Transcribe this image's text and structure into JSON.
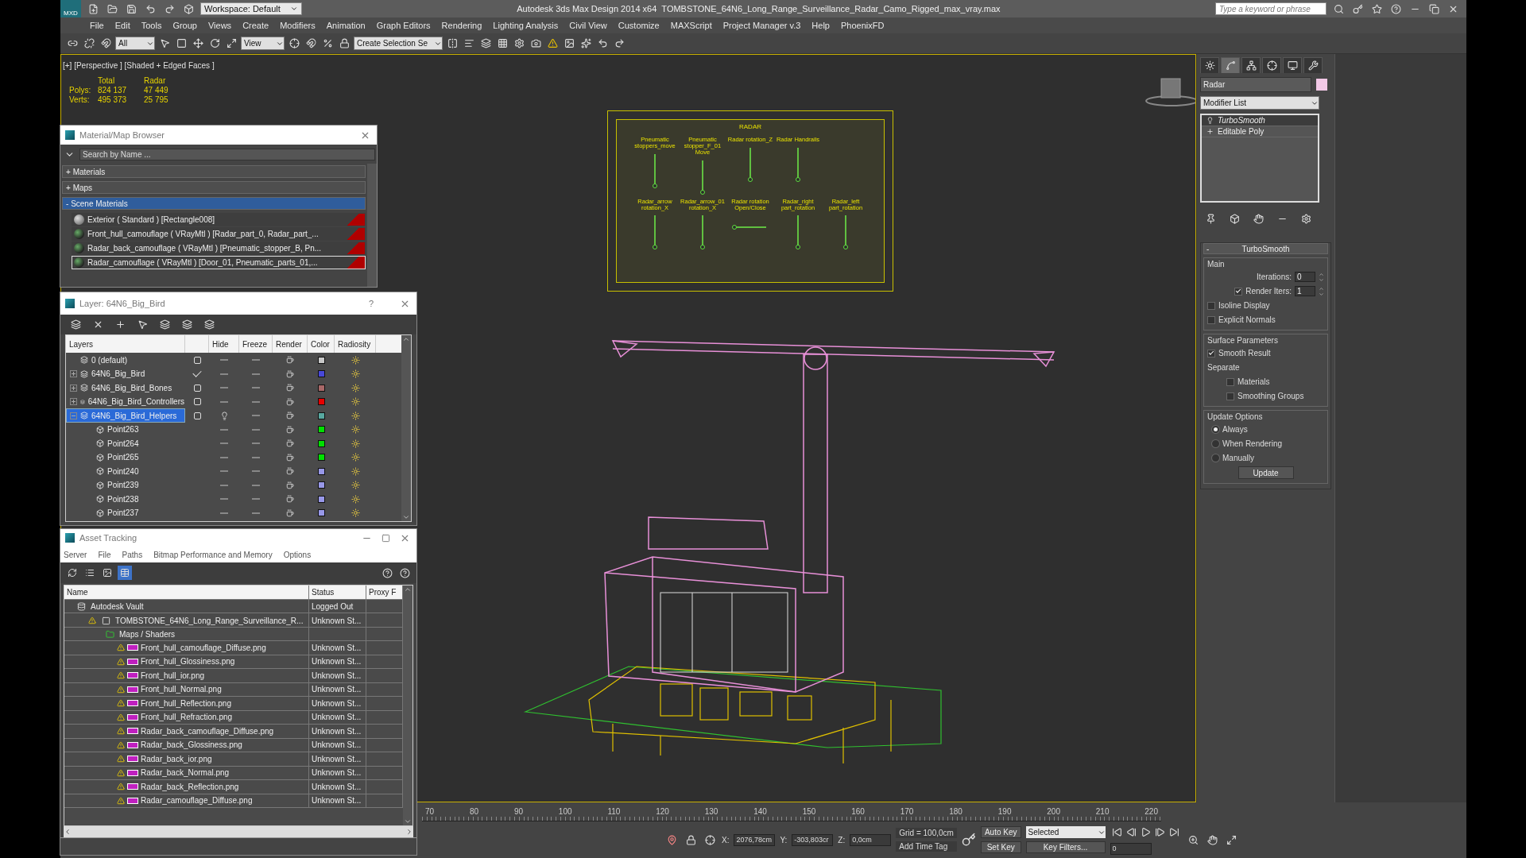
{
  "title_bar": {
    "logo": "MXD",
    "workspace": "Workspace: Default",
    "app_title": "Autodesk 3ds Max Design 2014 x64",
    "file_name": "TOMBSTONE_64N6_Long_Range_Surveillance_Radar_Camo_Rigged_max_vray.max",
    "search_placeholder": "Type a keyword or phrase"
  },
  "menu": [
    "File",
    "Edit",
    "Tools",
    "Group",
    "Views",
    "Create",
    "Modifiers",
    "Animation",
    "Graph Editors",
    "Rendering",
    "Lighting Analysis",
    "Civil View",
    "Customize",
    "MAXScript",
    "Project Manager v.3",
    "Help",
    "PhoenixFD"
  ],
  "toolbar": {
    "selection_filter": "All",
    "reference_coord": "View",
    "named_selection": "Create Selection Se"
  },
  "viewport": {
    "label": "[+] [Perspective ] [Shaded + Edged Faces ]",
    "stats": {
      "columns": [
        "Total",
        "Radar"
      ],
      "rows": [
        {
          "label": "Polys:",
          "values": [
            "824 137",
            "47 449"
          ]
        },
        {
          "label": "Verts:",
          "values": [
            "495 373",
            "25 795"
          ]
        }
      ]
    },
    "schematic": {
      "title": "RADAR",
      "top_controls": [
        {
          "label": "Pneumatic stoppers_move",
          "kind": "vertical"
        },
        {
          "label": "Pneumatic stopper_F_01 Move",
          "kind": "vertical"
        },
        {
          "label": "Radar rotation_Z",
          "kind": "vertical"
        },
        {
          "label": "Radar Handrails",
          "kind": "vertical"
        }
      ],
      "bottom_controls": [
        {
          "label": "Radar_arrow rotation_X",
          "kind": "vertical"
        },
        {
          "label": "Radar_arrow_01 rotation_X",
          "kind": "vertical"
        },
        {
          "label": "Radar rotation Open/Close",
          "kind": "horizontal"
        },
        {
          "label": "Radar_right part_rotation",
          "kind": "vertical"
        },
        {
          "label": "Radar_left part_rotation",
          "kind": "vertical"
        }
      ]
    }
  },
  "material_browser": {
    "title": "Material/Map Browser",
    "search_placeholder": "Search by Name ...",
    "groups": [
      {
        "marker": "+",
        "label": "Materials",
        "expanded": false
      },
      {
        "marker": "+",
        "label": "Maps",
        "expanded": false
      },
      {
        "marker": "-",
        "label": "Scene Materials",
        "expanded": true,
        "items": [
          {
            "name": "Exterior ( Standard ) [Rectangle008]",
            "kind": "standard",
            "selected": false
          },
          {
            "name": "Front_hull_camouflage ( VRayMtl ) [Radar_part_0, Radar_part_...",
            "kind": "vray",
            "selected": false
          },
          {
            "name": "Radar_back_camouflage ( VRayMtl ) [Pneumatic_stopper_B, Pn...",
            "kind": "vray",
            "selected": false
          },
          {
            "name": "Radar_camouflage ( VRayMtl ) [Door_01, Pneumatic_parts_01,...",
            "kind": "vray",
            "selected": true
          }
        ]
      }
    ]
  },
  "layer_manager": {
    "title": "Layer: 64N6_Big_Bird",
    "help": "?",
    "columns": [
      "Layers",
      "Hide",
      "Freeze",
      "Render",
      "Color",
      "Radiosity"
    ],
    "layers": [
      {
        "name": "0 (default)",
        "current": false,
        "hidden": false,
        "color": "#c8c8c8",
        "selected": false
      },
      {
        "name": "64N6_Big_Bird",
        "current": true,
        "hidden": false,
        "color": "#4848d8",
        "selected": false,
        "expanded": false
      },
      {
        "name": "64N6_Big_Bird_Bones",
        "current": false,
        "hidden": false,
        "color": "#a86868",
        "selected": false,
        "expanded": false
      },
      {
        "name": "64N6_Big_Bird_Controllers",
        "current": false,
        "hidden": false,
        "color": "#e80000",
        "selected": false,
        "expanded": false
      },
      {
        "name": "64N6_Big_Bird_Helpers",
        "current": false,
        "hidden": true,
        "color": "#58a8a0",
        "selected": true,
        "expanded": true,
        "children": [
          {
            "name": "Point263",
            "hidden": false,
            "color": "#00e000",
            "selected": false
          },
          {
            "name": "Point264",
            "hidden": false,
            "color": "#00e000",
            "selected": false
          },
          {
            "name": "Point265",
            "hidden": false,
            "color": "#00e000",
            "selected": false
          },
          {
            "name": "Point240",
            "hidden": false,
            "color": "#9898e8",
            "selected": false
          },
          {
            "name": "Point239",
            "hidden": false,
            "color": "#9898e8",
            "selected": false
          },
          {
            "name": "Point238",
            "hidden": false,
            "color": "#9898e8",
            "selected": false
          },
          {
            "name": "Point237",
            "hidden": false,
            "color": "#9898e8",
            "selected": false
          }
        ]
      }
    ]
  },
  "asset_tracking": {
    "title": "Asset Tracking",
    "menu": [
      "Server",
      "File",
      "Paths",
      "Bitmap Performance and Memory",
      "Options"
    ],
    "view_buttons": [
      {
        "kind": "refresh",
        "selected": false
      },
      {
        "kind": "list",
        "selected": false
      },
      {
        "kind": "thumbnails",
        "selected": false
      },
      {
        "kind": "table",
        "selected": true
      }
    ],
    "columns": [
      "Name",
      "Status",
      "Proxy F"
    ],
    "rows": [
      {
        "name": "Autodesk Vault",
        "status": "Logged Out",
        "kind": "vault",
        "warning": false,
        "children": [
          {
            "name": "TOMBSTONE_64N6_Long_Range_Surveillance_R...",
            "status": "Unknown St...",
            "kind": "scene",
            "warning": true,
            "children": [
              {
                "name": "Maps / Shaders",
                "kind": "folder",
                "warning": false,
                "children": [
                  {
                    "name": "Front_hull_camouflage_Diffuse.png",
                    "status": "Unknown St...",
                    "kind": "png",
                    "warning": true
                  },
                  {
                    "name": "Front_hull_Glossiness.png",
                    "status": "Unknown St...",
                    "kind": "png",
                    "warning": true
                  },
                  {
                    "name": "Front_hull_ior.png",
                    "status": "Unknown St...",
                    "kind": "png",
                    "warning": true
                  },
                  {
                    "name": "Front_hull_Normal.png",
                    "status": "Unknown St...",
                    "kind": "png",
                    "warning": true
                  },
                  {
                    "name": "Front_hull_Reflection.png",
                    "status": "Unknown St...",
                    "kind": "png",
                    "warning": true
                  },
                  {
                    "name": "Front_hull_Refraction.png",
                    "status": "Unknown St...",
                    "kind": "png",
                    "warning": true
                  },
                  {
                    "name": "Radar_back_camouflage_Diffuse.png",
                    "status": "Unknown St...",
                    "kind": "png",
                    "warning": true
                  },
                  {
                    "name": "Radar_back_Glossiness.png",
                    "status": "Unknown St...",
                    "kind": "png",
                    "warning": true
                  },
                  {
                    "name": "Radar_back_ior.png",
                    "status": "Unknown St...",
                    "kind": "png",
                    "warning": true
                  },
                  {
                    "name": "Radar_back_Normal.png",
                    "status": "Unknown St...",
                    "kind": "png",
                    "warning": true
                  },
                  {
                    "name": "Radar_back_Reflection.png",
                    "status": "Unknown St...",
                    "kind": "png",
                    "warning": true
                  },
                  {
                    "name": "Radar_camouflage_Diffuse.png",
                    "status": "Unknown St...",
                    "kind": "png",
                    "warning": true
                  }
                ]
              }
            ]
          }
        ]
      }
    ]
  },
  "command_panel": {
    "tabs": [
      {
        "kind": "create",
        "selected": false
      },
      {
        "kind": "modify",
        "selected": true
      },
      {
        "kind": "hierarchy",
        "selected": false
      },
      {
        "kind": "motion",
        "selected": false
      },
      {
        "kind": "display",
        "selected": false
      },
      {
        "kind": "utilities",
        "selected": false
      }
    ],
    "object_name": "Radar",
    "modifier_list": "Modifier List",
    "stack": [
      {
        "name": "TurboSmooth",
        "kind": "modifier",
        "selected": true
      },
      {
        "name": "Editable Poly",
        "kind": "base",
        "selected": false
      }
    ],
    "rollout": {
      "marker": "-",
      "title": "TurboSmooth",
      "groups": [
        {
          "title": "Main",
          "fields": [
            {
              "kind": "spinner",
              "label": "Iterations:",
              "value": "0"
            },
            {
              "kind": "check_spinner",
              "label": "Render Iters:",
              "checked": true,
              "value": "1"
            },
            {
              "kind": "checkbox",
              "label": "Isoline Display",
              "checked": false
            },
            {
              "kind": "checkbox",
              "label": "Explicit Normals",
              "checked": false
            }
          ]
        },
        {
          "title": "Surface Parameters",
          "fields": [
            {
              "kind": "checkbox",
              "label": "Smooth Result",
              "checked": true
            },
            {
              "kind": "label",
              "label": "Separate"
            },
            {
              "kind": "sub_checkbox",
              "label": "Materials",
              "checked": false
            },
            {
              "kind": "sub_checkbox",
              "label": "Smoothing Groups",
              "checked": false
            }
          ]
        },
        {
          "title": "Update Options",
          "fields": [
            {
              "kind": "radio",
              "label": "Always",
              "selected": true
            },
            {
              "kind": "radio",
              "label": "When Rendering",
              "selected": false
            },
            {
              "kind": "radio",
              "label": "Manually",
              "selected": false
            },
            {
              "kind": "button",
              "label": "Update"
            }
          ]
        }
      ]
    }
  },
  "timeline": {
    "ticks": [
      "70",
      "80",
      "90",
      "100",
      "110",
      "120",
      "130",
      "140",
      "150",
      "160",
      "170",
      "180",
      "190",
      "200",
      "210",
      "220"
    ]
  },
  "status_bar": {
    "x_label": "X:",
    "x": "2076,78cm",
    "y_label": "Y:",
    "y": "-303,803cr",
    "z_label": "Z:",
    "z": "0,0cm",
    "grid": "Grid = 100,0cm",
    "add_time_tag": "Add Time Tag",
    "auto_key": "Auto Key",
    "key_mode": "Selected",
    "set_key": "Set Key",
    "key_filters": "Key Filters...",
    "frame": "0"
  }
}
